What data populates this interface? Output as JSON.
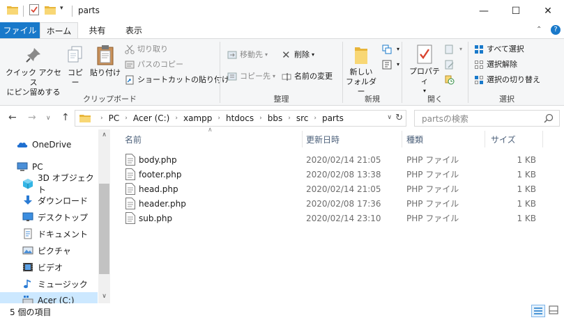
{
  "window": {
    "title": "parts",
    "minimize": "—",
    "maximize": "☐",
    "close": "✕"
  },
  "quick_access": {
    "dropdown": "▾"
  },
  "tabs": [
    {
      "label": "ファイル"
    },
    {
      "label": "ホーム"
    },
    {
      "label": "共有"
    },
    {
      "label": "表示"
    }
  ],
  "ribbon_ctrl": {
    "minimize": "⌃",
    "help": "?"
  },
  "ribbon": {
    "clipboard": {
      "label": "クリップボード",
      "pin_line1": "クイック アクセス",
      "pin_line2": "にピン留めする",
      "copy": "コピー",
      "paste": "貼り付け",
      "cut": "切り取り",
      "copy_path": "パスのコピー",
      "paste_shortcut": "ショートカットの貼り付け"
    },
    "organize": {
      "label": "整理",
      "move_to": "移動先",
      "copy_to": "コピー先",
      "delete": "削除",
      "rename": "名前の変更"
    },
    "new": {
      "label": "新規",
      "new_folder_line1": "新しい",
      "new_folder_line2": "フォルダー"
    },
    "open": {
      "label": "開く",
      "properties": "プロパティ"
    },
    "select": {
      "label": "選択",
      "select_all": "すべて選択",
      "select_none": "選択解除",
      "invert": "選択の切り替え"
    }
  },
  "address": {
    "crumbs": [
      "PC",
      "Acer (C:)",
      "xampp",
      "htdocs",
      "bbs",
      "src",
      "parts"
    ],
    "search_placeholder": "partsの検索"
  },
  "nav_pane": {
    "items": [
      {
        "label": "OneDrive",
        "icon": "cloud-icon"
      },
      {
        "label": "PC",
        "icon": "pc-icon"
      },
      {
        "label": "3D オブジェクト",
        "icon": "cube-icon"
      },
      {
        "label": "ダウンロード",
        "icon": "download-icon"
      },
      {
        "label": "デスクトップ",
        "icon": "desktop-icon"
      },
      {
        "label": "ドキュメント",
        "icon": "document-icon"
      },
      {
        "label": "ピクチャ",
        "icon": "picture-icon"
      },
      {
        "label": "ビデオ",
        "icon": "video-icon"
      },
      {
        "label": "ミュージック",
        "icon": "music-icon"
      },
      {
        "label": "Acer (C:)",
        "icon": "drive-icon"
      }
    ]
  },
  "file_list": {
    "columns": [
      "名前",
      "更新日時",
      "種類",
      "サイズ"
    ],
    "rows": [
      {
        "name": "body.php",
        "date": "2020/02/14 21:05",
        "type": "PHP ファイル",
        "size": "1 KB"
      },
      {
        "name": "footer.php",
        "date": "2020/02/08 13:38",
        "type": "PHP ファイル",
        "size": "1 KB"
      },
      {
        "name": "head.php",
        "date": "2020/02/14 21:05",
        "type": "PHP ファイル",
        "size": "1 KB"
      },
      {
        "name": "header.php",
        "date": "2020/02/08 17:36",
        "type": "PHP ファイル",
        "size": "1 KB"
      },
      {
        "name": "sub.php",
        "date": "2020/02/14 23:10",
        "type": "PHP ファイル",
        "size": "1 KB"
      }
    ]
  },
  "status": {
    "item_count": "5 個の項目"
  },
  "colors": {
    "accent": "#1979ca",
    "ribbon_bg": "#f5f6f7",
    "selected_bg": "#cce8ff",
    "folder_yellow": "#f8d775"
  }
}
